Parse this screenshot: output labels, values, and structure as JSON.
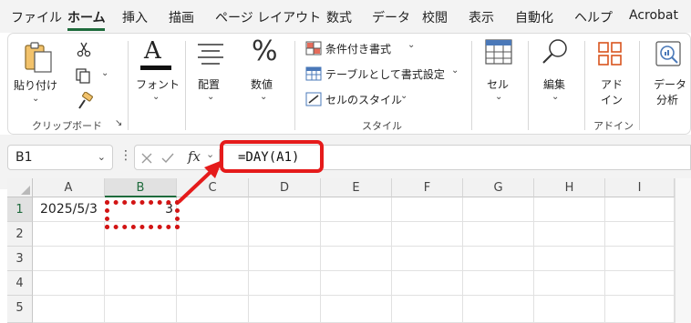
{
  "ribbon_tabs": [
    {
      "label": "ファイル"
    },
    {
      "label": "ホーム"
    },
    {
      "label": "挿入"
    },
    {
      "label": "描画"
    },
    {
      "label": "ページ レイアウト"
    },
    {
      "label": "数式"
    },
    {
      "label": "データ"
    },
    {
      "label": "校閲"
    },
    {
      "label": "表示"
    },
    {
      "label": "自動化"
    },
    {
      "label": "ヘルプ"
    },
    {
      "label": "Acrobat"
    }
  ],
  "ribbon": {
    "clipboard": {
      "paste_label": "貼り付け",
      "group_label": "クリップボード"
    },
    "font": {
      "label": "フォント"
    },
    "alignment": {
      "label": "配置"
    },
    "number": {
      "label": "数値"
    },
    "styles": {
      "conditional_format": "条件付き書式",
      "format_as_table": "テーブルとして書式設定",
      "cell_styles": "セルのスタイル",
      "group_label": "スタイル"
    },
    "cells": {
      "label": "セル"
    },
    "editing": {
      "label": "編集"
    },
    "addins": {
      "line1": "アド",
      "line2": "イン",
      "group_label": "アドイン"
    },
    "data_analysis": {
      "line1": "データ",
      "line2": "分析"
    }
  },
  "formula_bar": {
    "name_box": "B1",
    "fx_label": "fx",
    "formula": "=DAY(A1)"
  },
  "sheet": {
    "columns": [
      "A",
      "B",
      "C",
      "D",
      "E",
      "F",
      "G",
      "H",
      "I"
    ],
    "rows": [
      "1",
      "2",
      "3",
      "4",
      "5"
    ],
    "active_cell": "B1",
    "cells": {
      "A1": "2025/5/3",
      "B1": "3"
    }
  },
  "colors": {
    "accent": "#1e6b3c",
    "callout": "#e51b1b"
  }
}
